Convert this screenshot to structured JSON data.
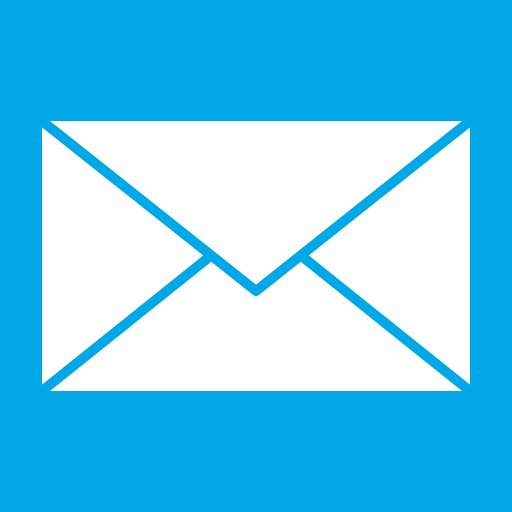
{
  "tile": {
    "icon": "mail-envelope-icon",
    "background_color": "#00A8E8",
    "icon_color": "#FFFFFF"
  }
}
